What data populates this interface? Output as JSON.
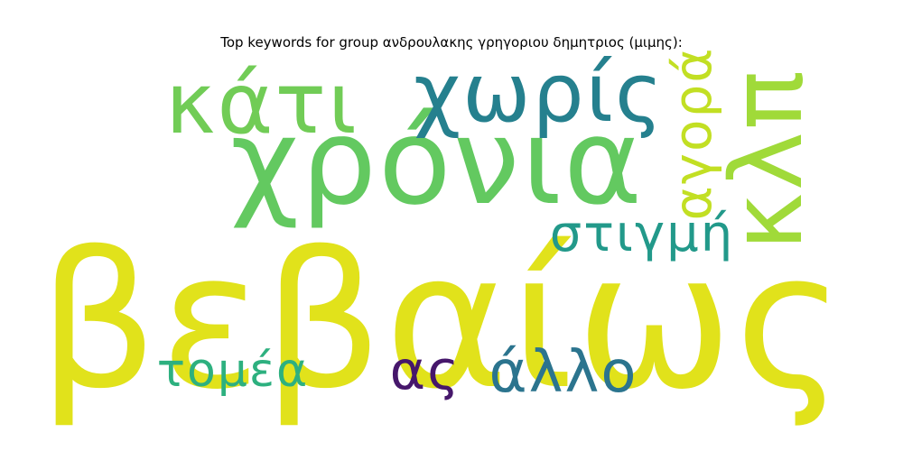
{
  "title": "Top keywords for group ανδρουλακης γρηγοριου δημητριος (μιμης):",
  "words": [
    {
      "text": "βεβαίως",
      "color": "#e1e21b"
    },
    {
      "text": "χρόνια",
      "color": "#63c960"
    },
    {
      "text": "κάτι",
      "color": "#71cc56"
    },
    {
      "text": "χωρίς",
      "color": "#25808e"
    },
    {
      "text": "κλπ",
      "color": "#a0da39"
    },
    {
      "text": "αγορά",
      "color": "#c2df23"
    },
    {
      "text": "στιγμή",
      "color": "#22998a"
    },
    {
      "text": "τομέα",
      "color": "#2db07f"
    },
    {
      "text": "ας",
      "color": "#46176b"
    },
    {
      "text": "άλλο",
      "color": "#2b748e"
    }
  ]
}
